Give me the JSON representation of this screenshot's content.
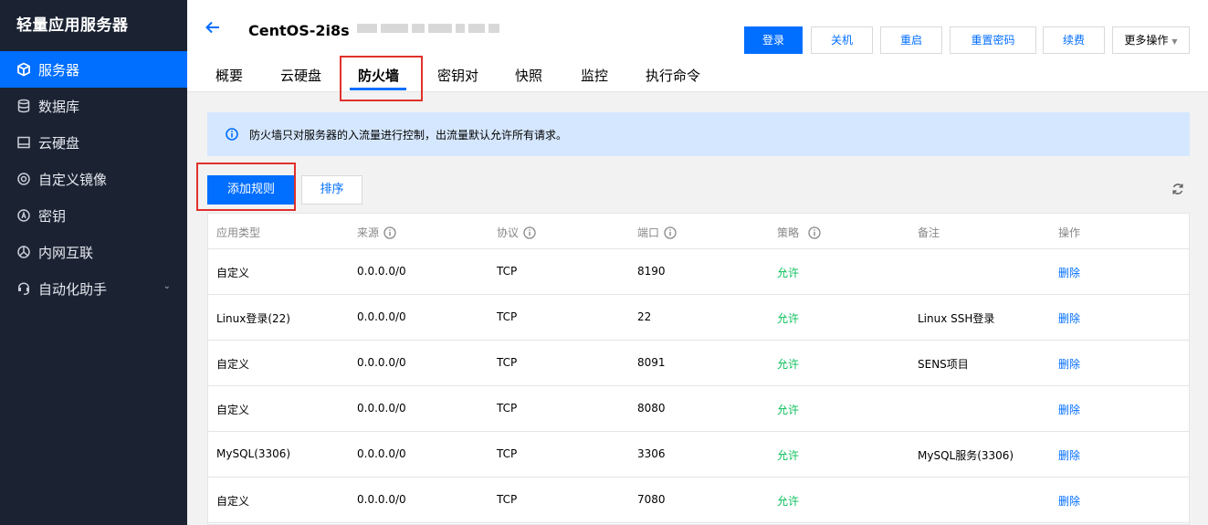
{
  "sidebar": {
    "title": "轻量应用服务器",
    "items": [
      {
        "label": "服务器",
        "icon": "server-icon"
      },
      {
        "label": "数据库",
        "icon": "database-icon"
      },
      {
        "label": "云硬盘",
        "icon": "disk-icon"
      },
      {
        "label": "自定义镜像",
        "icon": "image-icon"
      },
      {
        "label": "密钥",
        "icon": "key-icon"
      },
      {
        "label": "内网互联",
        "icon": "network-icon"
      },
      {
        "label": "自动化助手",
        "icon": "automation-icon"
      }
    ]
  },
  "header": {
    "instance_name": "CentOS-2i8s",
    "buttons": {
      "login": "登录",
      "shutdown": "关机",
      "restart": "重启",
      "reset_password": "重置密码",
      "renew": "续费",
      "more": "更多操作"
    }
  },
  "tabs": [
    "概要",
    "云硬盘",
    "防火墙",
    "密钥对",
    "快照",
    "监控",
    "执行命令"
  ],
  "active_tab": "防火墙",
  "notice": "防火墙只对服务器的入流量进行控制，出流量默认允许所有请求。",
  "actions": {
    "add_rule": "添加规则",
    "sort": "排序"
  },
  "table": {
    "headers": [
      "应用类型",
      "来源",
      "协议",
      "端口",
      "策略",
      "备注",
      "操作"
    ],
    "rows": [
      {
        "type": "自定义",
        "source": "0.0.0.0/0",
        "protocol": "TCP",
        "port": "8190",
        "policy": "允许",
        "note": "",
        "action": "删除"
      },
      {
        "type": "Linux登录(22)",
        "source": "0.0.0.0/0",
        "protocol": "TCP",
        "port": "22",
        "policy": "允许",
        "note": "Linux SSH登录",
        "action": "删除"
      },
      {
        "type": "自定义",
        "source": "0.0.0.0/0",
        "protocol": "TCP",
        "port": "8091",
        "policy": "允许",
        "note": "SENS项目",
        "action": "删除"
      },
      {
        "type": "自定义",
        "source": "0.0.0.0/0",
        "protocol": "TCP",
        "port": "8080",
        "policy": "允许",
        "note": "",
        "action": "删除"
      },
      {
        "type": "MySQL(3306)",
        "source": "0.0.0.0/0",
        "protocol": "TCP",
        "port": "3306",
        "policy": "允许",
        "note": "MySQL服务(3306)",
        "action": "删除"
      },
      {
        "type": "自定义",
        "source": "0.0.0.0/0",
        "protocol": "TCP",
        "port": "7080",
        "policy": "允许",
        "note": "",
        "action": "删除"
      }
    ]
  },
  "colors": {
    "sidebar_bg": "#1b2333",
    "accent": "#006eff",
    "allow": "#0abf5b",
    "highlight": "#e0312b",
    "notice_bg": "#d5e7fe"
  }
}
